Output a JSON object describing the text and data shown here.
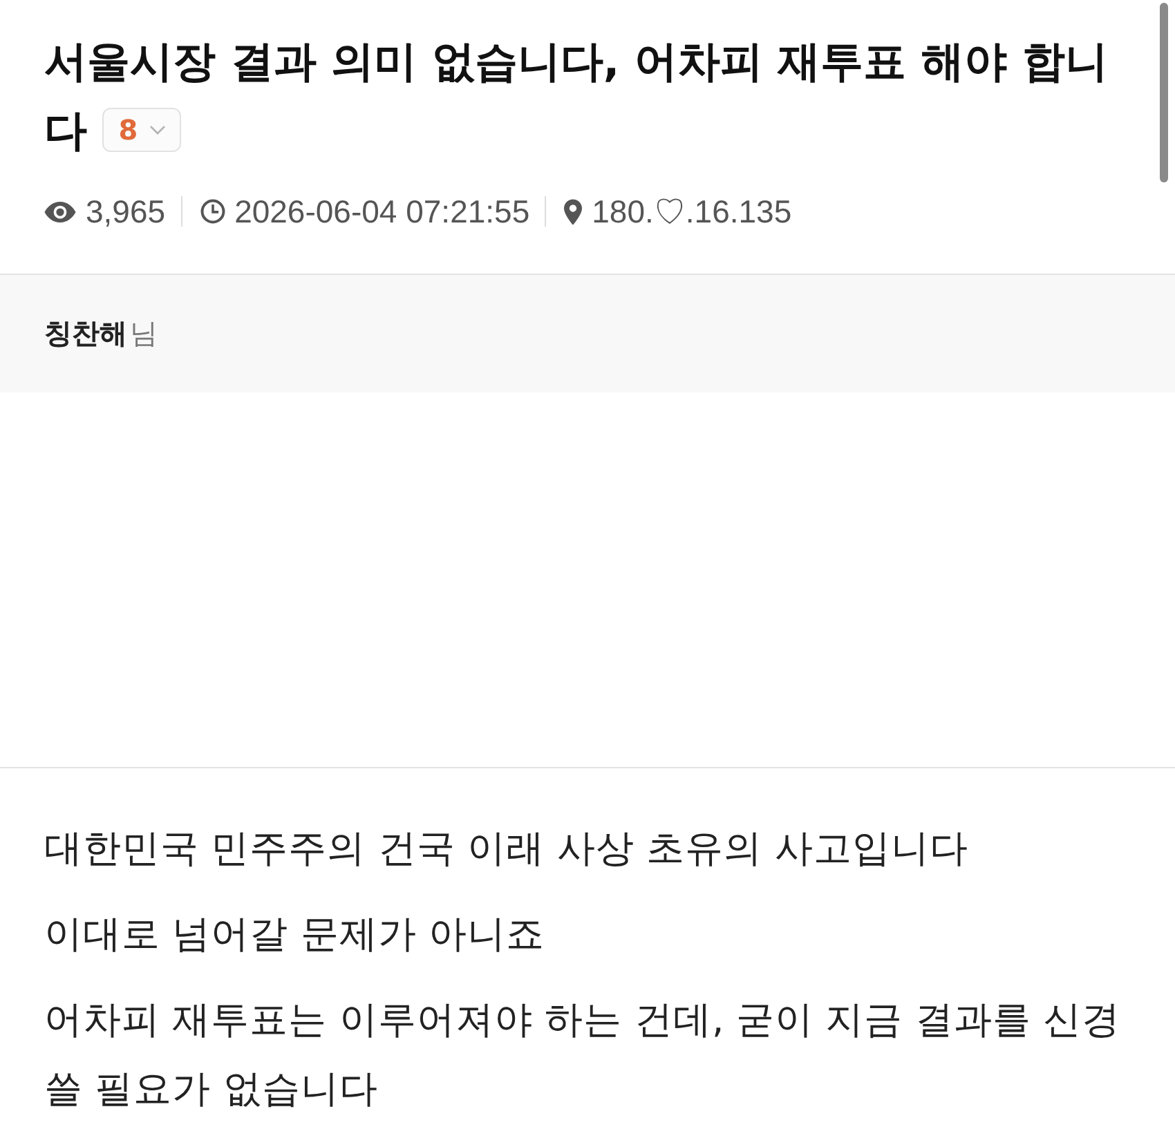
{
  "post": {
    "title": "서울시장 결과 의미 없습니다, 어차피 재투표 해야 합니다",
    "comment_count": "8"
  },
  "meta": {
    "views": "3,965",
    "datetime": "2026-06-04 07:21:55",
    "ip": "180.♡.16.135"
  },
  "author": {
    "name": "칭찬해",
    "suffix": "님"
  },
  "body": {
    "paragraphs": [
      "대한민국 민주주의 건국 이래 사상 초유의 사고입니다",
      "이대로 넘어갈 문제가 아니죠",
      "어차피 재투표는 이루어져야 하는 건데, 굳이 지금 결과를 신경 쓸 필요가 없습니다"
    ]
  }
}
